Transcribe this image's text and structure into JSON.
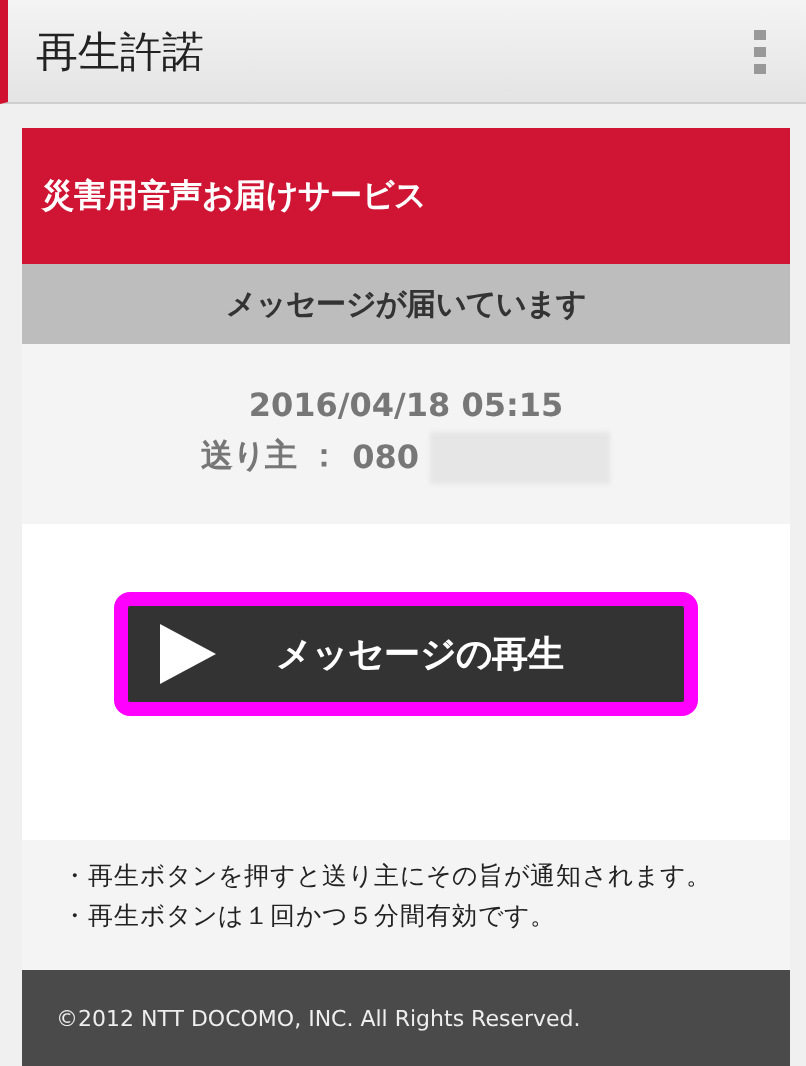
{
  "header": {
    "title": "再生許諾"
  },
  "banner": {
    "title": "災害用音声お届けサービス"
  },
  "status": {
    "text": "メッセージが届いています"
  },
  "message": {
    "datetime": "2016/04/18 05:15",
    "sender_label": "送り主 ：",
    "sender_number": "080"
  },
  "play_button": {
    "label": "メッセージの再生",
    "focused": true
  },
  "notes": [
    "・再生ボタンを押すと送り主にその旨が通知されます。",
    "・再生ボタンは１回かつ５分間有効です。"
  ],
  "footer": {
    "copyright": "©2012 NTT DOCOMO, INC. All Rights Reserved."
  }
}
